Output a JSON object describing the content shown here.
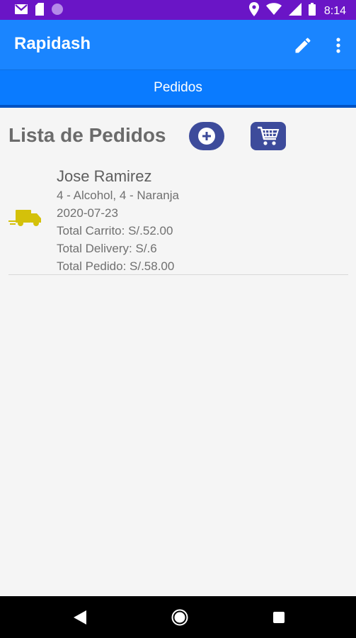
{
  "status_bar": {
    "time": "8:14",
    "icons": [
      "gmail-icon",
      "sim-card-icon",
      "circle-icon",
      "location-icon",
      "wifi-icon",
      "cell-signal-icon",
      "battery-icon"
    ]
  },
  "app_bar": {
    "title": "Rapidash",
    "actions": [
      "pencil-icon",
      "more-vert-icon"
    ]
  },
  "tabs": [
    {
      "label": "Pedidos",
      "selected": true
    }
  ],
  "list": {
    "title": "Lista de Pedidos",
    "actions": [
      "add-circle-icon",
      "shopping-cart-icon"
    ]
  },
  "orders": [
    {
      "icon": "delivery-truck-icon",
      "name": "Jose Ramirez",
      "items": "4 - Alcohol, 4 - Naranja",
      "date": "2020-07-23",
      "total_carrito": "Total Carrito: S/.52.00",
      "total_delivery": "Total Delivery: S/.6",
      "total_pedido": "Total Pedido: S/.58.00"
    }
  ],
  "colors": {
    "status_bar": "#6a15c6",
    "app_bar": "#1a85ff",
    "tab_bar": "#0a7bff",
    "button": "#3d4b9b",
    "truck": "#d4c10a"
  }
}
